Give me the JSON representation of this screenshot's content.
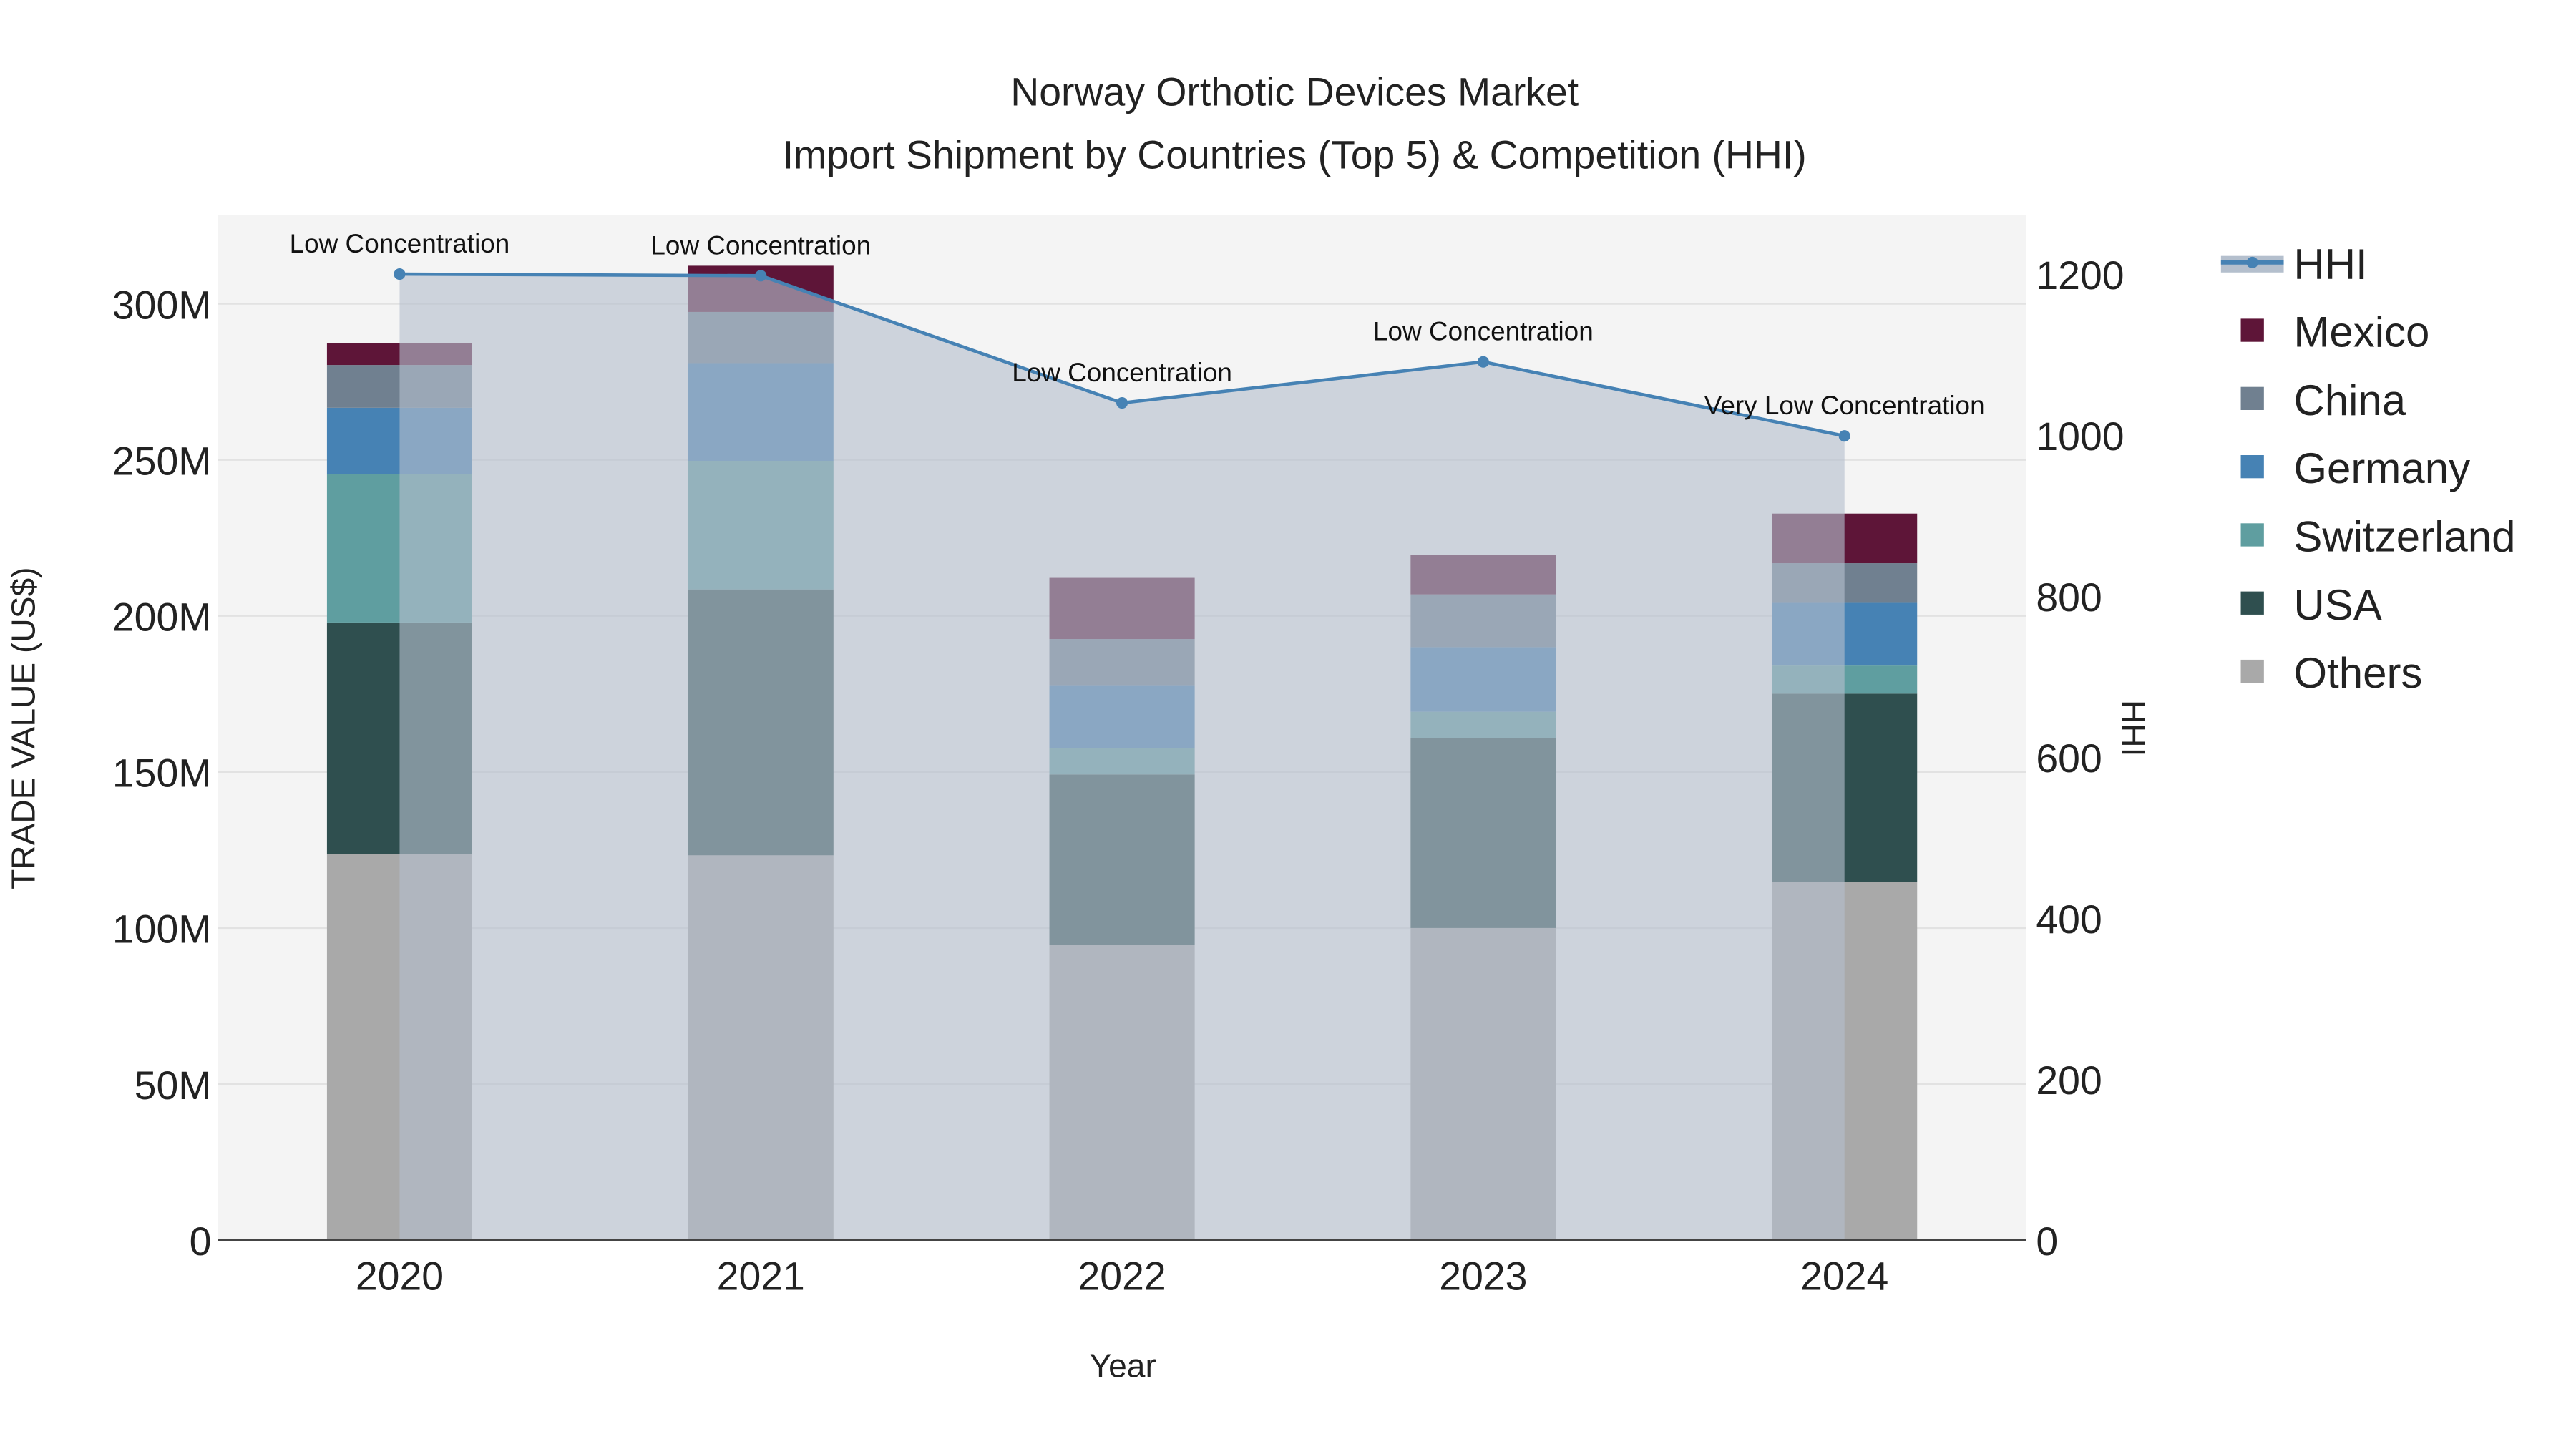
{
  "chart_data": {
    "type": "bar",
    "stacked": true,
    "title": "Norway Orthotic Devices Market",
    "subtitle": "Import Shipment by Countries (Top 5) & Competition (HHI)",
    "xlabel": "Year",
    "ylabel": "TRADE VALUE (US$)",
    "y2label": "HHI",
    "categories": [
      "2020",
      "2021",
      "2022",
      "2023",
      "2024"
    ],
    "ylim": [
      0,
      320
    ],
    "y2lim": [
      0,
      1280
    ],
    "yticks": [
      {
        "v": 0,
        "label": "0"
      },
      {
        "v": 50,
        "label": "50M"
      },
      {
        "v": 100,
        "label": "100M"
      },
      {
        "v": 150,
        "label": "150M"
      },
      {
        "v": 200,
        "label": "200M"
      },
      {
        "v": 250,
        "label": "250M"
      },
      {
        "v": 300,
        "label": "300M"
      }
    ],
    "y2ticks": [
      {
        "v": 0,
        "label": "0"
      },
      {
        "v": 200,
        "label": "200"
      },
      {
        "v": 400,
        "label": "400"
      },
      {
        "v": 600,
        "label": "600"
      },
      {
        "v": 800,
        "label": "800"
      },
      {
        "v": 1000,
        "label": "1000"
      },
      {
        "v": 1200,
        "label": "1200"
      }
    ],
    "series": [
      {
        "name": "Others",
        "color": "#a9a9a9",
        "values": [
          123.8,
          123.3,
          94.7,
          100.0,
          114.8
        ]
      },
      {
        "name": "USA",
        "color": "#2f4f4f",
        "values": [
          74.1,
          85.2,
          54.5,
          60.8,
          60.3
        ]
      },
      {
        "name": "Switzerland",
        "color": "#5f9ea0",
        "values": [
          47.6,
          41.2,
          8.5,
          8.5,
          9.0
        ]
      },
      {
        "name": "Germany",
        "color": "#4682b4",
        "values": [
          21.2,
          31.3,
          20.1,
          20.7,
          20.1
        ]
      },
      {
        "name": "China",
        "color": "#708090",
        "values": [
          13.7,
          16.4,
          14.8,
          16.9,
          12.7
        ]
      },
      {
        "name": "Mexico",
        "color": "#5e1538",
        "values": [
          6.9,
          14.8,
          19.6,
          12.7,
          15.9
        ]
      }
    ],
    "line": {
      "name": "HHI",
      "color": "#4682b4",
      "values": [
        1200,
        1198,
        1040,
        1091,
        999
      ],
      "annotations": [
        "Low Concentration",
        "Low Concentration",
        "Low Concentration",
        "Low Concentration",
        "Very Low Concentration"
      ]
    },
    "legend": [
      "HHI",
      "Mexico",
      "China",
      "Germany",
      "Switzerland",
      "USA",
      "Others"
    ],
    "legend_position": "right",
    "grid": true
  }
}
